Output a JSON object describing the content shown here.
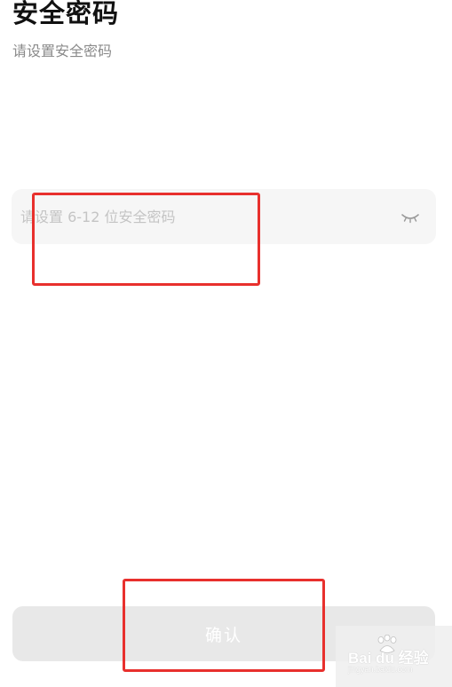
{
  "header": {
    "title": "安全密码",
    "subtitle": "请设置安全密码"
  },
  "password_field": {
    "value": "",
    "placeholder": "请设置 6-12 位安全密码",
    "visibility_icon": "eye-closed-icon"
  },
  "confirm_button": {
    "label": "确认",
    "enabled": false
  },
  "annotations": {
    "color": "#e8302d"
  },
  "watermark": {
    "text": "Bai du 经验",
    "subtext": "jingyan.baidu.com"
  },
  "colors": {
    "background": "#ffffff",
    "field_background": "#f6f6f6",
    "button_disabled": "#e8e8e8",
    "placeholder": "#c4c4c4",
    "subtitle": "#8a8a8a"
  }
}
